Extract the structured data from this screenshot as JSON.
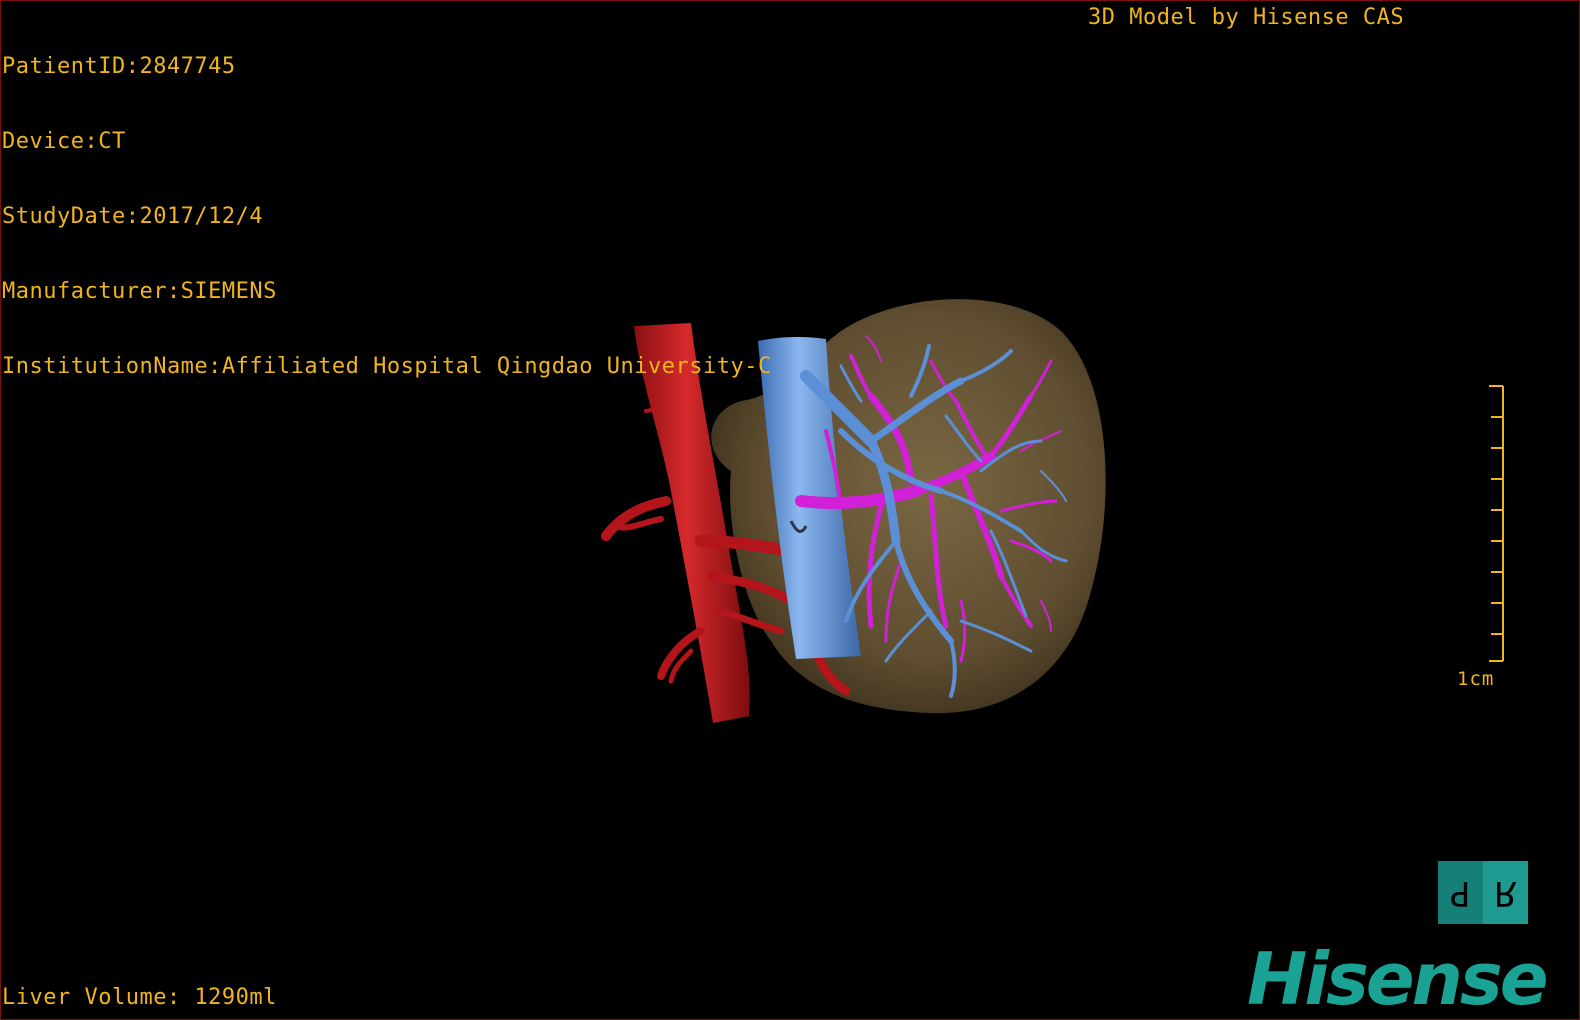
{
  "patient_info": {
    "patient_id": "PatientID:2847745",
    "device": "Device:CT",
    "study_date": "StudyDate:2017/12/4",
    "manufacturer": "Manufacturer:SIEMENS",
    "institution": "InstitutionName:Affiliated Hospital Qingdao University-C"
  },
  "model_credit": "3D Model by Hisense CAS",
  "liver_volume": "Liver Volume: 1290ml",
  "scale": {
    "label": "1cm"
  },
  "orientation_cube": {
    "left_face": "P",
    "right_face": "R"
  },
  "brand": "Hisense",
  "colors": {
    "overlay_text": "#f0b41e",
    "artery": "#b3151a",
    "vein": "#5b8fd6",
    "portal_vein": "#d21fd8",
    "liver": "#6a5838",
    "brand": "#1aa394"
  }
}
